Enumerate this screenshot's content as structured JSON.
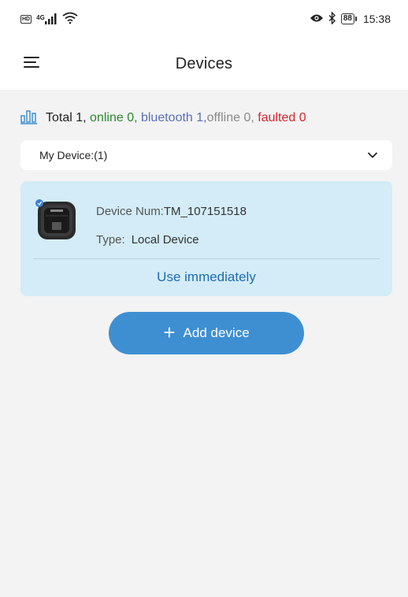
{
  "status_bar": {
    "hd": "HD",
    "network": "4G",
    "battery": "88",
    "time": "15:38",
    "icons": [
      "hd-icon",
      "signal-icon",
      "wifi-icon",
      "eye-icon",
      "bluetooth-icon",
      "battery-icon"
    ]
  },
  "header": {
    "title": "Devices",
    "menu_icon": "hamburger-menu-icon"
  },
  "stats": {
    "icon": "bar-chart-icon",
    "total": "Total 1,",
    "online": " online 0,",
    "bluetooth": " bluetooth 1,",
    "offline": "offline 0,",
    "faulted": " faulted 0",
    "colors": {
      "online": "#2a8a2e",
      "bluetooth": "#5a6fb8",
      "offline": "#8a8a8a",
      "faulted": "#d8242b"
    }
  },
  "device_select": {
    "label": "My Device:(1)",
    "icon": "chevron-down-icon"
  },
  "device_card": {
    "num_label": "Device Num:",
    "num_value": "TM_107151518",
    "type_label": "Type:",
    "type_value": "Local Device",
    "action": "Use immediately",
    "thumbnail": "device-thumbnail",
    "background": "#d3ecf7"
  },
  "add_button": {
    "plus": "+",
    "label": "Add device",
    "color": "#3e8fd2"
  }
}
